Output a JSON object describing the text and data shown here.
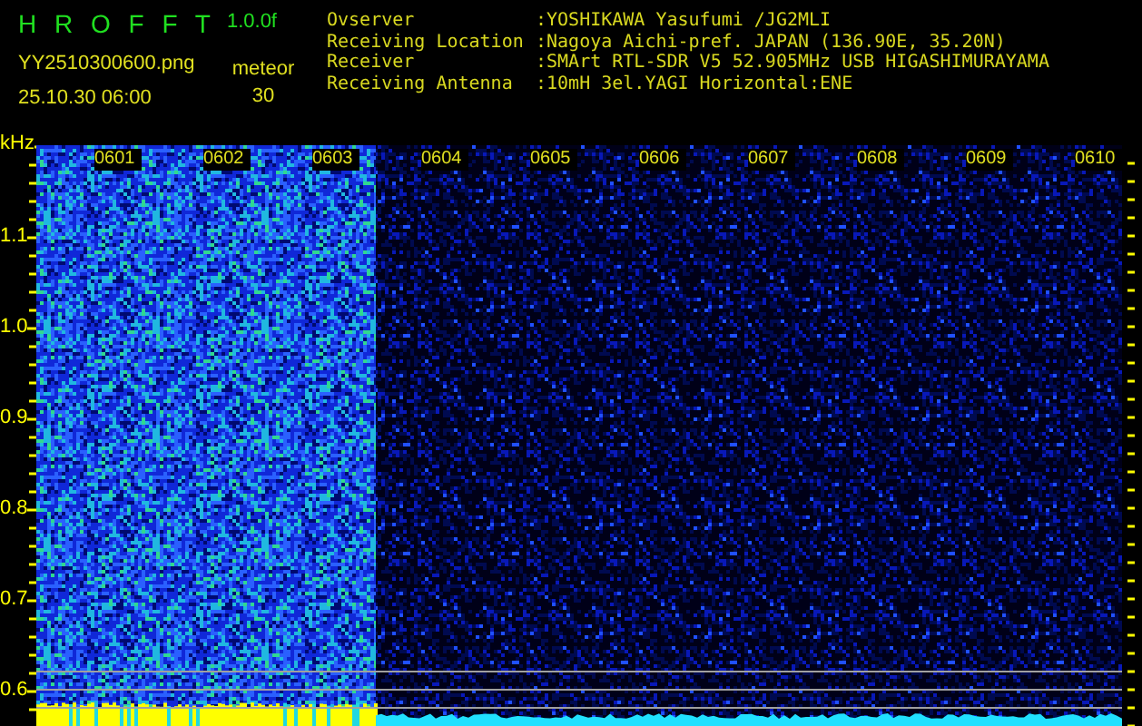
{
  "app": {
    "title": "H R O F F T",
    "version": "1.0.0f"
  },
  "file": {
    "name": "YY2510300600.png",
    "datetime": "25.10.30 06:00"
  },
  "detection": {
    "label": "meteor",
    "count": "30"
  },
  "info": [
    {
      "label": "Ovserver",
      "value": ":YOSHIKAWA Yasufumi /JG2MLI"
    },
    {
      "label": "Receiving Location",
      "value": ":Nagoya Aichi-pref. JAPAN (136.90E, 35.20N)"
    },
    {
      "label": "Receiver",
      "value": ":SMArt RTL-SDR V5 52.905MHz USB HIGASHIMURAYAMA"
    },
    {
      "label": "Receiving Antenna",
      "value": ":10mH 3el.YAGI Horizontal:ENE"
    }
  ],
  "y_axis": {
    "unit": "kHz",
    "labels": [
      "1.1",
      "1.0",
      "0.9",
      "0.8",
      "0.7",
      "0.6"
    ]
  },
  "time_labels": [
    "0601",
    "0602",
    "0603",
    "0604",
    "0605",
    "0606",
    "0607",
    "0608",
    "0609",
    "0610"
  ]
}
